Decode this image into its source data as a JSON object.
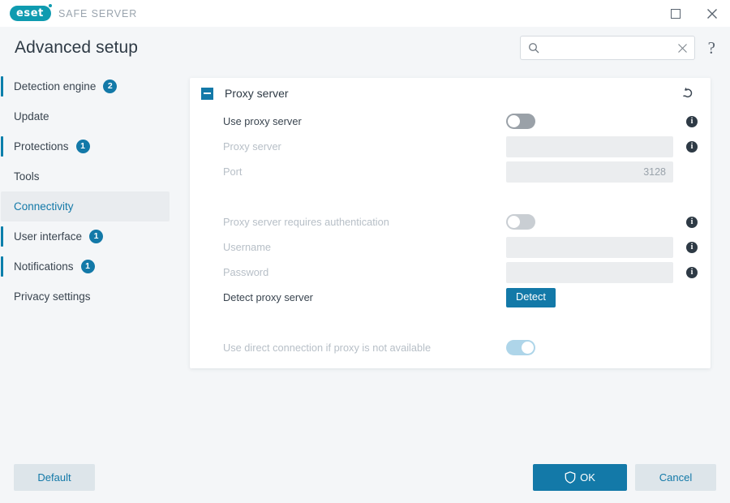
{
  "titlebar": {
    "brand_mark": "eset",
    "product": "SAFE SERVER",
    "maximize_label": "Maximize",
    "close_label": "Close"
  },
  "header": {
    "title": "Advanced setup",
    "search": {
      "value": "",
      "placeholder": "",
      "search_icon": "search-icon",
      "clear_icon": "close-icon"
    },
    "help_label": "?"
  },
  "sidebar": {
    "items": [
      {
        "label": "Detection engine",
        "badge": "2",
        "accent": true,
        "selected": false
      },
      {
        "label": "Update",
        "badge": "",
        "accent": false,
        "selected": false
      },
      {
        "label": "Protections",
        "badge": "1",
        "accent": true,
        "selected": false
      },
      {
        "label": "Tools",
        "badge": "",
        "accent": false,
        "selected": false
      },
      {
        "label": "Connectivity",
        "badge": "",
        "accent": false,
        "selected": true
      },
      {
        "label": "User interface",
        "badge": "1",
        "accent": true,
        "selected": false
      },
      {
        "label": "Notifications",
        "badge": "1",
        "accent": true,
        "selected": false
      },
      {
        "label": "Privacy settings",
        "badge": "",
        "accent": false,
        "selected": false
      }
    ]
  },
  "panel": {
    "title": "Proxy server",
    "collapse_icon": "minus-square-icon",
    "revert_icon": "revert-arrow-icon",
    "rows": {
      "use_proxy": {
        "label": "Use proxy server",
        "toggle_state": "off",
        "disabled": false,
        "has_info": true
      },
      "proxy_server": {
        "label": "Proxy server",
        "value": "",
        "placeholder": "",
        "disabled": true,
        "has_info": true
      },
      "port": {
        "label": "Port",
        "value": "3128",
        "placeholder": "",
        "disabled": true,
        "has_info": false
      },
      "requires_auth": {
        "label": "Proxy server requires authentication",
        "toggle_state": "off",
        "disabled": true,
        "has_info": true
      },
      "username": {
        "label": "Username",
        "value": "",
        "placeholder": "",
        "disabled": true,
        "has_info": true
      },
      "password": {
        "label": "Password",
        "value": "",
        "placeholder": "",
        "disabled": true,
        "has_info": true
      },
      "detect": {
        "label": "Detect proxy server",
        "button_label": "Detect",
        "disabled": false,
        "has_info": false
      },
      "direct_connection": {
        "label": "Use direct connection if proxy is not available",
        "toggle_state": "on",
        "disabled": true,
        "has_info": false
      }
    }
  },
  "footer": {
    "default_label": "Default",
    "ok_label": "OK",
    "ok_icon": "shield-icon",
    "cancel_label": "Cancel"
  },
  "colors": {
    "accent_blue": "#1379a8",
    "brand_teal": "#0f9bb0",
    "toggle_on_muted": "#aed5e9",
    "toggle_off": "#9aa1a8",
    "canvas": "#f4f6f8"
  }
}
